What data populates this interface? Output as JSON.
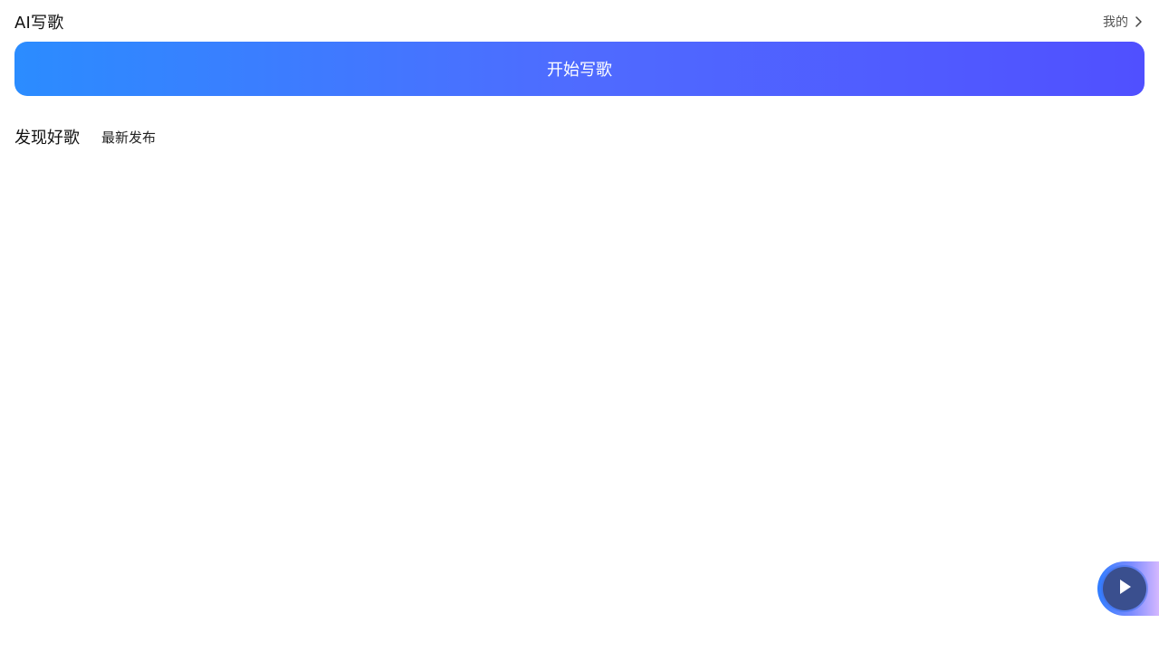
{
  "header": {
    "title": "AI写歌",
    "mine_label": "我的",
    "mine_icon": "chevron-right-icon"
  },
  "main": {
    "start_button_label": "开始写歌"
  },
  "tabs": [
    {
      "label": "发现好歌"
    },
    {
      "label": "最新发布"
    }
  ],
  "player": {
    "icon": "play-icon"
  },
  "colors": {
    "button_gradient_start": "#2b8cff",
    "button_gradient_end": "#5050ff",
    "text_primary": "#111111",
    "text_secondary": "#555555"
  }
}
